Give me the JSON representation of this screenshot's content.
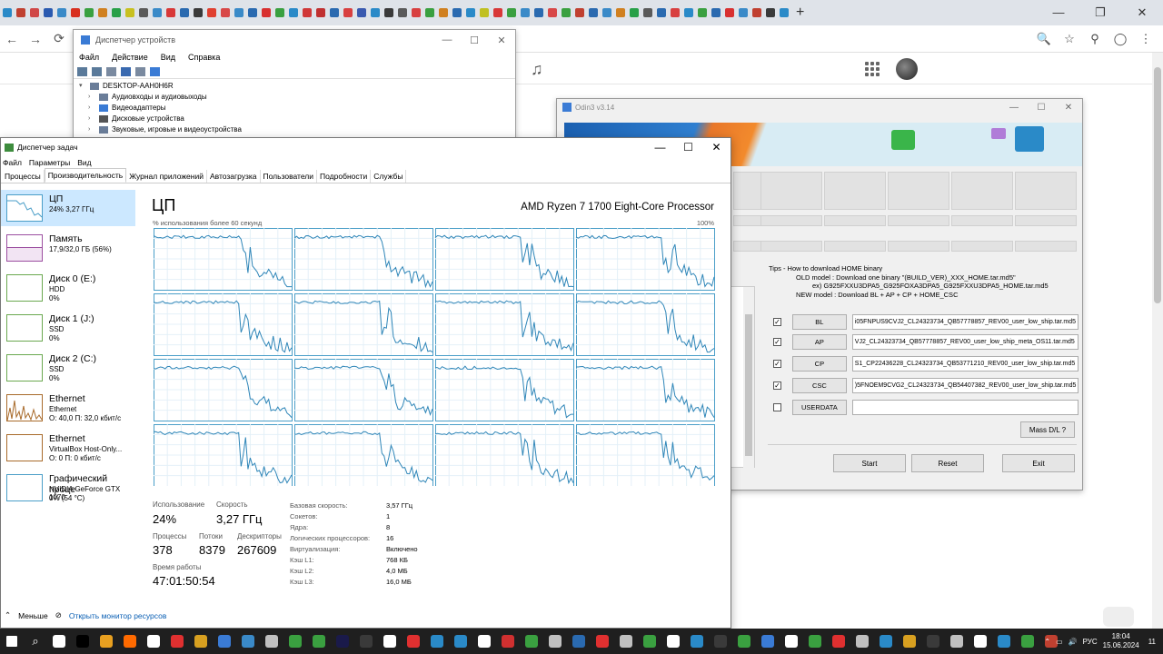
{
  "browser": {
    "tab_colors": [
      "#2a8ac8",
      "#c04030",
      "#d04848",
      "#2a5ab0",
      "#3a8ac8",
      "#d83020",
      "#3aa040",
      "#d08020",
      "#28a048",
      "#c8c020",
      "#5a5a5a",
      "#3a8ac8",
      "#d83838",
      "#2a6ab0",
      "#3a3a3a",
      "#e04030",
      "#d84848",
      "#3a8ac8",
      "#2a6ab0",
      "#d83030",
      "#3aa040",
      "#2a8ac8",
      "#d03838",
      "#c03030",
      "#2a6ab0",
      "#d84040",
      "#3a5ab0",
      "#2a8ac8",
      "#3a3a3a",
      "#5a5a5a",
      "#d84040",
      "#3aa040",
      "#d08020",
      "#2a6ab0",
      "#2a8ac8",
      "#c0c020",
      "#d83838",
      "#3aa040",
      "#3a8ac8",
      "#2a6ab0",
      "#d84848",
      "#3aa040",
      "#c04030",
      "#2a6ab0",
      "#3a8ac8",
      "#d08020",
      "#28a048",
      "#5a5a5a",
      "#2a6ab0",
      "#d84040",
      "#2a8ac8",
      "#3aa040",
      "#2a6ab0",
      "#d83030",
      "#3a8ac8",
      "#c04030",
      "#3a3a3a",
      "#2a8ac8"
    ],
    "new_tab": "+",
    "win_min": "—",
    "win_max": "❐",
    "win_close": "✕",
    "back": "←",
    "forward": "→",
    "reload": "⟳",
    "zoom": "🔍",
    "star": "☆",
    "ext1": "⚲",
    "profile": "◯",
    "menu": "⋮"
  },
  "device_manager": {
    "title": "Диспетчер устройств",
    "menu": [
      "Файл",
      "Действие",
      "Вид",
      "Справка"
    ],
    "win_min": "—",
    "win_max": "☐",
    "win_close": "✕",
    "tree": [
      {
        "label": "DESKTOP-AAH0H6R",
        "toggle": "▾"
      },
      {
        "label": "Аудиовходы и аудиовыходы",
        "toggle": "›"
      },
      {
        "label": "Видеоадаптеры",
        "toggle": "›"
      },
      {
        "label": "Дисковые устройства",
        "toggle": "›"
      },
      {
        "label": "Звуковые, игровые и видеоустройства",
        "toggle": "›"
      }
    ]
  },
  "odin": {
    "title": "Odin3 v3.14",
    "win_min": "—",
    "win_max": "☐",
    "win_close": "✕",
    "tips": {
      "heading": "Tips - How to download HOME binary",
      "old_line1": "OLD model : Download one binary    \"(BUILD_VER)_XXX_HOME.tar.md5\"",
      "old_line2": "ex) G925FXXU3DPA5_G925FOXA3DPA5_G925FXXU3DPA5_HOME.tar.md5",
      "new_line": "NEW model : Download BL + AP + CP + HOME_CSC"
    },
    "files": [
      {
        "label": "BL",
        "checked": "✓",
        "path": "i05FNPUS9CVJ2_CL24323734_QB57778857_REV00_user_low_ship.tar.md5"
      },
      {
        "label": "AP",
        "checked": "✓",
        "path": "VJ2_CL24323734_QB57778857_REV00_user_low_ship_meta_OS11.tar.md5"
      },
      {
        "label": "CP",
        "checked": "✓",
        "path": "S1_CP22436228_CL24323734_QB53771210_REV00_user_low_ship.tar.md5"
      },
      {
        "label": "CSC",
        "checked": "✓",
        "path": ")5FNOEM9CVG2_CL24323734_QB54407382_REV00_user_low_ship.tar.md5"
      },
      {
        "label": "USERDATA",
        "checked": "",
        "path": ""
      }
    ],
    "mass_dl": "Mass D/L ?",
    "start": "Start",
    "reset": "Reset",
    "exit": "Exit"
  },
  "task_manager": {
    "title": "Диспетчер задач",
    "win_min": "—",
    "win_max": "☐",
    "win_close": "✕",
    "menu": [
      "Файл",
      "Параметры",
      "Вид"
    ],
    "tabs": [
      "Процессы",
      "Производительность",
      "Журнал приложений",
      "Автозагрузка",
      "Пользователи",
      "Подробности",
      "Службы"
    ],
    "active_tab": 1,
    "sidebar": [
      {
        "name": "ЦП",
        "line2": "24% 3,27 ГГц",
        "line3": "",
        "color": "#4a9ec8"
      },
      {
        "name": "Память",
        "line2": "17,9/32,0 ГБ (56%)",
        "line3": "",
        "color": "#9b4ea0"
      },
      {
        "name": "Диск 0 (E:)",
        "line2": "HDD",
        "line3": "0%",
        "color": "#6aa84f"
      },
      {
        "name": "Диск 1 (J:)",
        "line2": "SSD",
        "line3": "0%",
        "color": "#6aa84f"
      },
      {
        "name": "Диск 2 (C:)",
        "line2": "SSD",
        "line3": "0%",
        "color": "#6aa84f"
      },
      {
        "name": "Ethernet",
        "line2": "Ethernet",
        "line3": "О: 40,0  П: 32,0 кбит/с",
        "color": "#a86a2a"
      },
      {
        "name": "Ethernet",
        "line2": "VirtualBox Host-Only...",
        "line3": "О: 0  П: 0 кбит/с",
        "color": "#a86a2a"
      },
      {
        "name": "Графический проце",
        "line2": "NVIDIA GeForce GTX 1070",
        "line3": "0% (54 °C)",
        "color": "#4a9ec8"
      }
    ],
    "cpu": {
      "heading": "ЦП",
      "processor": "AMD Ryzen 7 1700 Eight-Core Processor",
      "graph_caption": "% использования более 60 секунд",
      "graph_max": "100%",
      "usage_label": "Использование",
      "usage_value": "24%",
      "speed_label": "Скорость",
      "speed_value": "3,27 ГГц",
      "processes_label": "Процессы",
      "processes_value": "378",
      "threads_label": "Потоки",
      "threads_value": "8379",
      "handles_label": "Дескрипторы",
      "handles_value": "267609",
      "uptime_label": "Время работы",
      "uptime_value": "47:01:50:54",
      "details": [
        {
          "k": "Базовая скорость:",
          "v": "3,57 ГГц"
        },
        {
          "k": "Сокетов:",
          "v": "1"
        },
        {
          "k": "Ядра:",
          "v": "8"
        },
        {
          "k": "Логических процессоров:",
          "v": "16"
        },
        {
          "k": "Виртуализация:",
          "v": "Включено"
        },
        {
          "k": "Кэш L1:",
          "v": "768 КБ"
        },
        {
          "k": "Кэш L2:",
          "v": "4,0 МБ"
        },
        {
          "k": "Кэш L3:",
          "v": "16,0 МБ"
        }
      ]
    },
    "footer_less": "Меньше",
    "footer_monitor": "Открыть монитор ресурсов"
  },
  "taskbar": {
    "app_colors": [
      "#ffffff",
      "#000000",
      "#e8a020",
      "#ff6a00",
      "#ffffff",
      "#e03030",
      "#d8a020",
      "#3a7bd5",
      "#3a8ac8",
      "#c0c0c0",
      "#3aa040",
      "#3aa040",
      "#1a1a4a",
      "#3a3a3a",
      "#ffffff",
      "#e03030",
      "#2a8ac8",
      "#2a8ac8",
      "#ffffff",
      "#d03030",
      "#3aa040",
      "#c0c0c0",
      "#2a6ab0",
      "#e03030",
      "#c0c0c0",
      "#3aa040",
      "#ffffff",
      "#2a8ac8",
      "#3a3a3a",
      "#3aa040",
      "#3a7bd5",
      "#ffffff",
      "#3aa040",
      "#e03030",
      "#c0c0c0",
      "#2a8ac8",
      "#d8a020",
      "#3a3a3a",
      "#c0c0c0",
      "#ffffff",
      "#2a8ac8",
      "#3aa040",
      "#c04030"
    ],
    "lang": "РУС",
    "time": "18:04",
    "date": "15.06.2024",
    "notif": "11"
  }
}
